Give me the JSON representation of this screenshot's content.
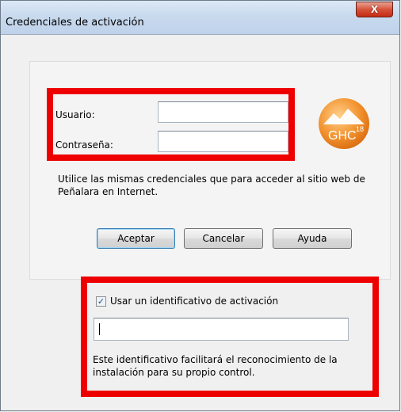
{
  "window": {
    "title": "Credenciales de activación",
    "close_symbol": "X"
  },
  "login": {
    "usuario_label": "Usuario:",
    "usuario_value": "",
    "password_label": "Contraseña:",
    "password_value": "",
    "note": "Utilice las mismas credenciales que para acceder al sitio web de Peñalara en Internet."
  },
  "logo": {
    "text": "GHC",
    "superscript": "18"
  },
  "buttons": {
    "accept": "Aceptar",
    "cancel": "Cancelar",
    "help": "Ayuda"
  },
  "activation": {
    "checkbox_label": "Usar un identificativo de activación",
    "checked": true,
    "identifier_value": "",
    "note": "Este identificativo facilitará el reconocimiento de la instalación para su propio control."
  },
  "colors": {
    "highlight": "#ee0000",
    "logo_orange": "#f2922e"
  }
}
